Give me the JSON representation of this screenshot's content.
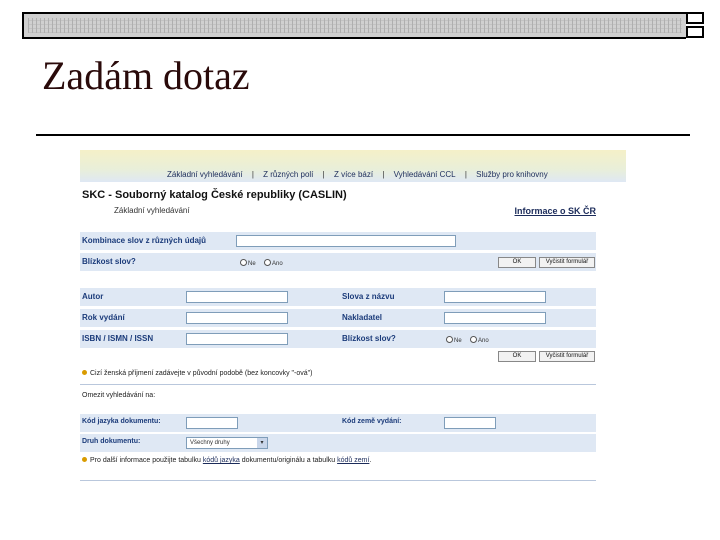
{
  "slide": {
    "title": "Zadám dotaz"
  },
  "nav": {
    "items": [
      "Základní vyhledávání",
      "Z různých polí",
      "Z více bází",
      "Vyhledávání CCL",
      "Služby pro knihovny"
    ],
    "separator": "|"
  },
  "catalog": {
    "title": "SKC - Souborný katalog České republiky (CASLIN)",
    "subtitle": "Základní vyhledávání",
    "info_link": "Informace o SK ČR"
  },
  "basic": {
    "combo_label": "Kombinace slov z různých údajů",
    "proximity_label": "Blízkost slov?",
    "radio_no": "Ne",
    "radio_yes": "Ano",
    "ok": "OK",
    "clear": "Vyčistit formulář"
  },
  "fields": {
    "author": "Autor",
    "year": "Rok vydání",
    "isbn": "ISBN / ISMN / ISSN",
    "title_words": "Slova z názvu",
    "publisher": "Nakladatel",
    "proximity": "Blízkost slov?",
    "radio_no": "Ne",
    "radio_yes": "Ano",
    "ok": "OK",
    "clear": "Vyčistit formulář"
  },
  "note1": "Cizí ženská příjmení zadávejte v původní podobě (bez koncovky \"-ová\")",
  "restrict": {
    "label": "Omezit vyhledávání na:",
    "lang_label": "Kód jazyka dokumentu:",
    "country_label": "Kód země vydání:",
    "doctype_label": "Druh dokumentu:",
    "doctype_value": "Všechny druhy"
  },
  "note2": {
    "prefix": "Pro další informace použijte tabulku ",
    "link1": "kódů jazyka",
    "middle": " dokumentu/originálu a tabulku ",
    "link2": "kódů zemí",
    "suffix": "."
  }
}
